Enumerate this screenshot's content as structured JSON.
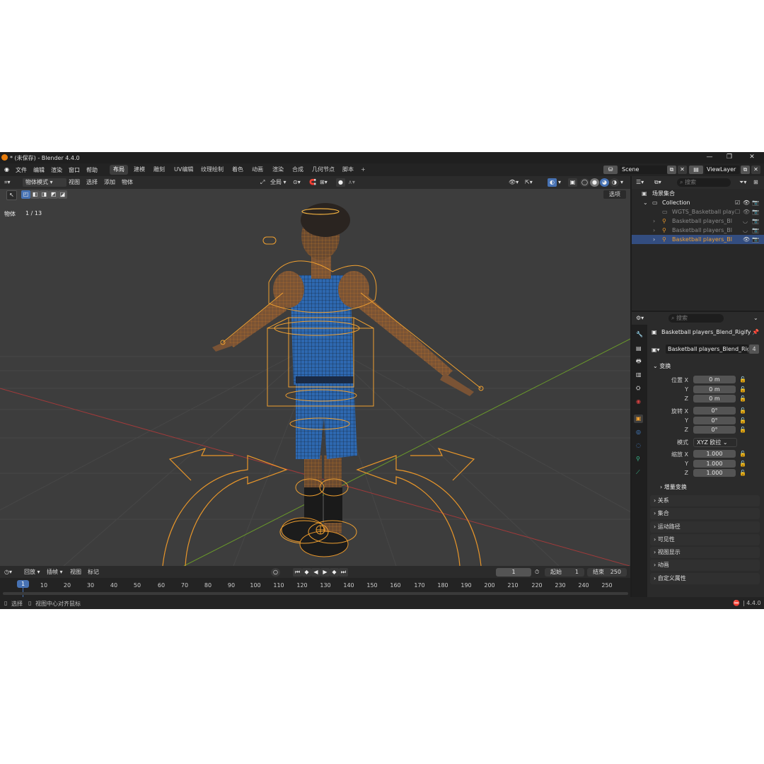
{
  "window": {
    "title": "* (未保存) - Blender 4.4.0"
  },
  "menus": [
    "文件",
    "编辑",
    "渲染",
    "窗口",
    "帮助"
  ],
  "workspaces": [
    "布局",
    "建模",
    "雕刻",
    "UV编辑",
    "纹理绘制",
    "着色",
    "动画",
    "渲染",
    "合成",
    "几何节点",
    "脚本"
  ],
  "workspace_add": "+",
  "scene": {
    "name": "Scene",
    "view_layer": "ViewLayer"
  },
  "viewport": {
    "mode": "物体模式",
    "menus": [
      "视图",
      "选择",
      "添加",
      "物体"
    ],
    "transform_orientation": "全局",
    "options_label": "选项",
    "info_label": "物体",
    "info_count": "1 / 13"
  },
  "outliner": {
    "search_placeholder": "搜索",
    "rows": [
      {
        "label": "场景集合"
      },
      {
        "label": "Collection"
      },
      {
        "label": "WGTS_Basketball playe"
      },
      {
        "label": "Basketball players_Blen"
      },
      {
        "label": "Basketball players_Blen"
      },
      {
        "label": "Basketball players_Blen"
      }
    ]
  },
  "properties": {
    "search_placeholder": "搜索",
    "object_name": "Basketball players_Blend_Rigify",
    "datablock_name": "Basketball players_Blend_Rigify",
    "user_count": "4",
    "transform_title": "变换",
    "location_label": "位置 X",
    "rotation_label": "旋转 X",
    "scale_label": "缩放 X",
    "axis_y": "Y",
    "axis_z": "Z",
    "location": [
      "0 m",
      "0 m",
      "0 m"
    ],
    "rotation": [
      "0°",
      "0°",
      "0°"
    ],
    "mode_label": "模式",
    "rotation_mode": "XYZ 欧拉",
    "scale": [
      "1.000",
      "1.000",
      "1.000"
    ],
    "delta_transform": "增量变换",
    "panels": [
      "关系",
      "集合",
      "运动路径",
      "可见性",
      "视图显示",
      "动画",
      "自定义属性"
    ]
  },
  "timeline": {
    "menus": [
      "回放",
      "插帧",
      "视图",
      "标记"
    ],
    "current_frame": "1",
    "start_label": "起始",
    "start": "1",
    "end_label": "结束",
    "end": "250",
    "ticks": [
      "1",
      "10",
      "20",
      "30",
      "40",
      "50",
      "60",
      "70",
      "80",
      "90",
      "100",
      "110",
      "120",
      "130",
      "140",
      "150",
      "160",
      "170",
      "180",
      "190",
      "200",
      "210",
      "220",
      "230",
      "240",
      "250"
    ]
  },
  "status": {
    "select": "选择",
    "center_view": "视图中心对齐鼠标",
    "version": "4.4.0"
  },
  "colors": {
    "accent": "#4772b3",
    "selection_orange": "#f0a030",
    "jersey_blue": "#2e68b0",
    "background": "#3d3d3d"
  }
}
